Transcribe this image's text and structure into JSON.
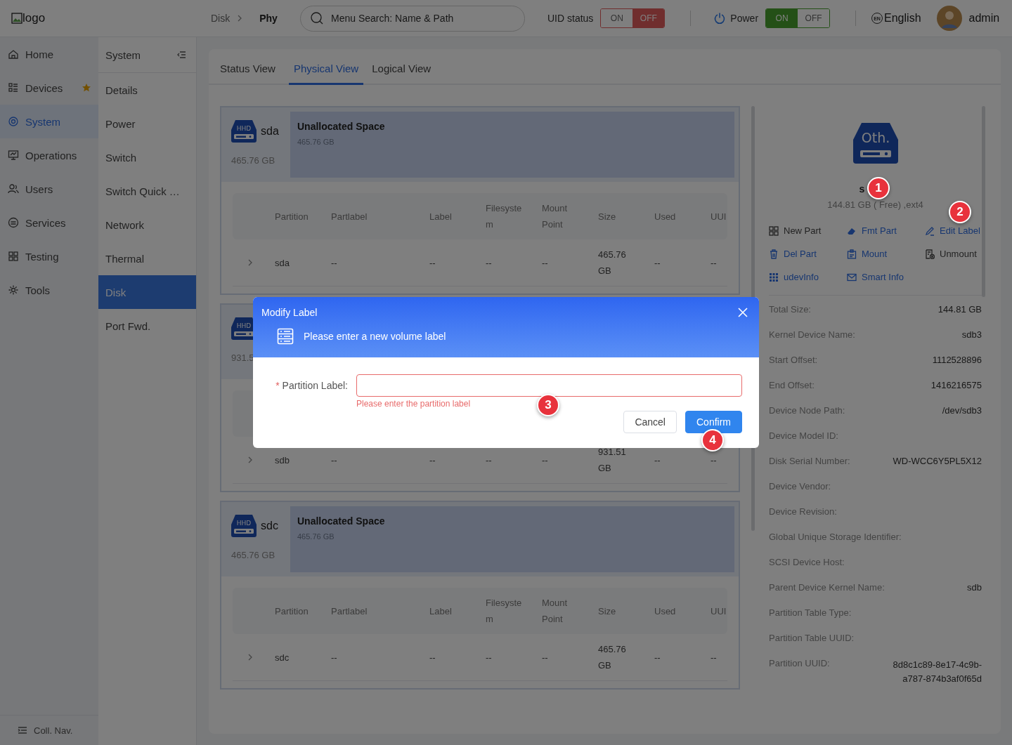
{
  "header": {
    "logo_alt": "logo",
    "breadcrumb": [
      {
        "label": "Disk"
      },
      {
        "label": "Phy"
      }
    ],
    "search": {
      "placeholder": "Menu Search: Name & Path"
    },
    "toggles": [
      {
        "label": "UID status",
        "kind": "danger",
        "options": [
          {
            "label": "ON",
            "selected": false
          },
          {
            "label": "OFF",
            "selected": true
          }
        ]
      },
      {
        "label": "Power",
        "kind": "success",
        "options": [
          {
            "label": "ON",
            "selected": true
          },
          {
            "label": "OFF",
            "selected": false
          }
        ]
      }
    ],
    "language": {
      "badge": "EN",
      "label": "English"
    },
    "user": {
      "name": "admin"
    }
  },
  "nav": {
    "items": [
      {
        "label": "Home",
        "selected": false,
        "starred": false
      },
      {
        "label": "Devices",
        "selected": false,
        "starred": true
      },
      {
        "label": "System",
        "selected": true,
        "starred": false
      },
      {
        "label": "Operations",
        "selected": false,
        "starred": false
      },
      {
        "label": "Users",
        "selected": false,
        "starred": false
      },
      {
        "label": "Services",
        "selected": false,
        "starred": false
      },
      {
        "label": "Testing",
        "selected": false,
        "starred": false
      },
      {
        "label": "Tools",
        "selected": false,
        "starred": false
      }
    ],
    "collapse": "Coll. Nav."
  },
  "subnav": {
    "title": "System",
    "items": [
      {
        "label": "Details",
        "selected": false
      },
      {
        "label": "Power",
        "selected": false
      },
      {
        "label": "Switch",
        "selected": false
      },
      {
        "label": "Switch Quick …",
        "selected": false
      },
      {
        "label": "Network",
        "selected": false
      },
      {
        "label": "Thermal",
        "selected": false
      },
      {
        "label": "Disk",
        "selected": true
      },
      {
        "label": "Port Fwd.",
        "selected": false
      }
    ]
  },
  "tabs": [
    {
      "label": "Status View",
      "selected": false
    },
    {
      "label": "Physical View",
      "selected": true
    },
    {
      "label": "Logical View",
      "selected": false
    }
  ],
  "disks": [
    {
      "type": "HHD",
      "name": "sda",
      "size": "465.76 GB",
      "segment": {
        "title": "Unallocated Space",
        "size": "465.76 GB"
      },
      "columns": [
        "Partition",
        "Partlabel",
        "Label",
        "Filesystem",
        "Mount Point",
        "Size",
        "Used",
        "UUI"
      ],
      "rows": [
        {
          "expanded": false,
          "cells": [
            "sda",
            "--",
            "--",
            "--",
            "--",
            "465.76 GB",
            "--",
            "--"
          ]
        }
      ]
    },
    {
      "type": "HHD",
      "size": "931.5",
      "rows": [
        {
          "expanded": false,
          "cells": [
            "sdb",
            "--",
            "--",
            "--",
            "--",
            "931.51 GB",
            "--",
            "--"
          ]
        }
      ]
    },
    {
      "type": "HHD",
      "name": "sdc",
      "size": "465.76 GB",
      "segment": {
        "title": "Unallocated Space",
        "size": "465.76 GB"
      },
      "columns": [
        "Partition",
        "Partlabel",
        "Label",
        "Filesystem",
        "Mount Point",
        "Size",
        "Used",
        "UUI"
      ],
      "rows": [
        {
          "expanded": false,
          "cells": [
            "sdc",
            "--",
            "--",
            "--",
            "--",
            "465.76 GB",
            "--",
            "--"
          ]
        }
      ]
    }
  ],
  "detail": {
    "type": "Oth.",
    "name": "s",
    "summary": "144.81 GB ( Free) ,ext4",
    "actions": [
      {
        "label": "New Part",
        "disabled": true
      },
      {
        "label": "Fmt Part",
        "disabled": false
      },
      {
        "label": "Edit Label",
        "disabled": false
      },
      {
        "label": "Del Part",
        "disabled": false
      },
      {
        "label": "Mount",
        "disabled": false
      },
      {
        "label": "Unmount",
        "disabled": true
      },
      {
        "label": "udevInfo",
        "disabled": false
      },
      {
        "label": "Smart Info",
        "disabled": false
      }
    ],
    "info": [
      {
        "label": "Total Size:",
        "value": "144.81 GB"
      },
      {
        "label": "Kernel Device Name:",
        "value": "sdb3"
      },
      {
        "label": "Start Offset:",
        "value": "1112528896"
      },
      {
        "label": "End Offset:",
        "value": "1416216575"
      },
      {
        "label": "Device Node Path:",
        "value": "/dev/sdb3"
      },
      {
        "label": "Device Model ID:"
      },
      {
        "label": "Disk Serial Number:",
        "value": "WD-WCC6Y5PL5X12"
      },
      {
        "label": "Device Vendor:"
      },
      {
        "label": "Device Revision:"
      },
      {
        "label": "Global Unique Storage Identifier:"
      },
      {
        "label": "SCSI Device Host:"
      },
      {
        "label": "Parent Device Kernel Name:",
        "value": "sdb"
      },
      {
        "label": "Partition Table Type:"
      },
      {
        "label": "Partition Table UUID:"
      },
      {
        "label": "Partition UUID:",
        "value": "8d8c1c89-8e17-4c9b-a787-874b3af0f65d"
      }
    ]
  },
  "modal": {
    "title": "Modify Label",
    "subtitle": "Please enter a new volume label",
    "field": {
      "required": true,
      "required_mark": "*",
      "label": "Partition Label:",
      "error": "Please enter the partition label"
    },
    "buttons": [
      {
        "label": "Cancel",
        "kind": "default"
      },
      {
        "label": "Confirm",
        "kind": "primary"
      }
    ]
  },
  "annotations": [
    "1",
    "2",
    "3",
    "4"
  ]
}
